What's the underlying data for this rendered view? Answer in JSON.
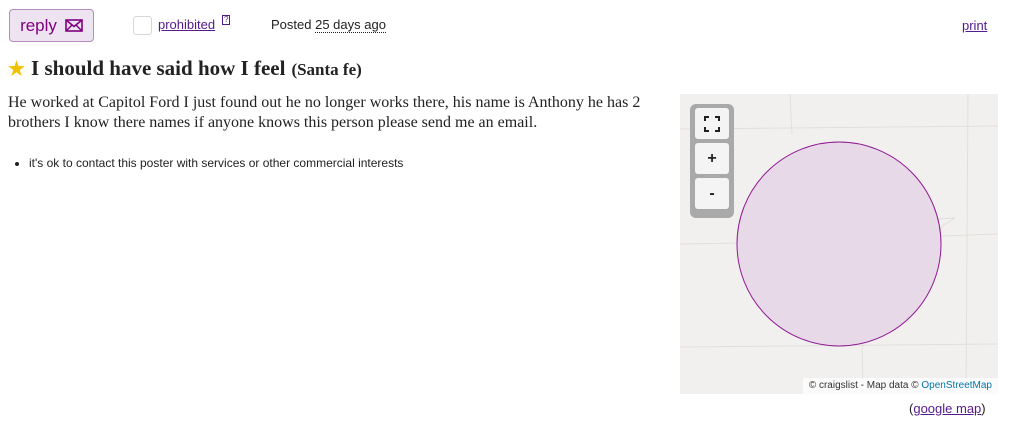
{
  "header": {
    "reply_label": "reply",
    "prohibited_label": "prohibited",
    "help_label": "?",
    "posted_prefix": "Posted",
    "posted_ago": "25 days ago",
    "print_label": "print"
  },
  "posting": {
    "title": "I should have said how I feel",
    "location": "(Santa fe)",
    "body": "He worked at Capitol Ford I just found out he no longer works there, his name is Anthony he has 2 brothers I know there names if anyone knows this person please send me an email.",
    "notices": [
      "it's ok to contact this poster with services or other commercial interests"
    ]
  },
  "map": {
    "zoom_in": "+",
    "zoom_out": "-",
    "attribution_prefix": "© craigslist - Map data ©",
    "attribution_link": "OpenStreetMap",
    "google_open": "(",
    "google_map_label": "google map",
    "google_close": ")",
    "circle_fill": "#e8d9e8",
    "circle_stroke": "#8e1a93"
  },
  "icons": {
    "reply": "envelope-icon",
    "favorite": "star-icon",
    "fullscreen": "fullscreen-icon"
  },
  "colors": {
    "link": "#551a8b",
    "reply_bg": "#eee3f0",
    "star": "#f2c200"
  }
}
